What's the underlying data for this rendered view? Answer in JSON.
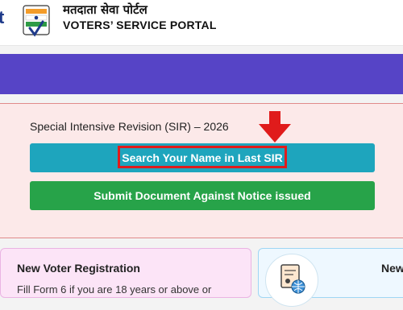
{
  "header": {
    "edge_text": "t",
    "brand_hindi": "मतदाता सेवा पोर्टल",
    "brand_english": "VOTERS’ SERVICE PORTAL",
    "logo_icon": "eci-voting-logo-icon"
  },
  "sir": {
    "title": "Special Intensive Revision (SIR) – 2026",
    "search_button": "Search Your Name in Last SIR",
    "submit_button": "Submit Document Against Notice issued",
    "arrow_icon": "red-down-arrow-icon",
    "colors": {
      "search": "#1ea5bd",
      "submit": "#27a349",
      "highlight": "#e01b1b"
    }
  },
  "cards": {
    "new_voter": {
      "title": "New Voter Registration",
      "desc": "Fill Form 6 if you are 18 years or above or"
    },
    "second": {
      "title": "New",
      "icon": "document-globe-icon"
    }
  },
  "colors": {
    "banner": "#5644c6"
  }
}
